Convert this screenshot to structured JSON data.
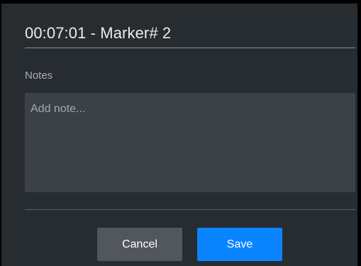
{
  "dialog": {
    "title": "00:07:01 - Marker# 2",
    "notes_label": "Notes",
    "note_value": "",
    "note_placeholder": "Add note...",
    "cancel_label": "Cancel",
    "save_label": "Save"
  },
  "colors": {
    "background": "#272c31",
    "input_background": "#3b4146",
    "cancel_button": "#51575c",
    "save_button": "#0a84ff"
  }
}
